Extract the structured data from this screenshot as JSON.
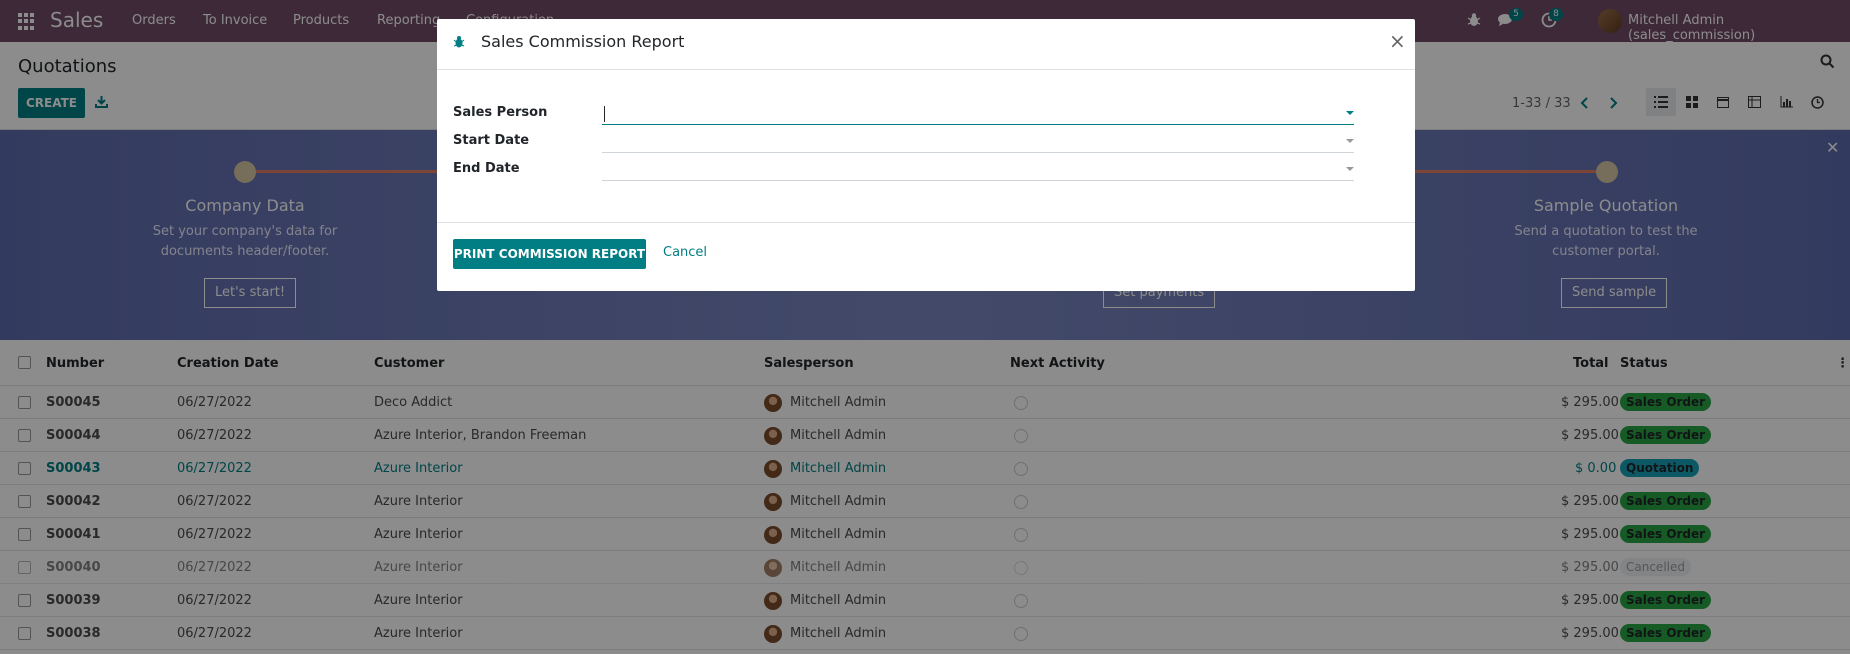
{
  "navbar": {
    "brand": "Sales",
    "menu": [
      "Orders",
      "To Invoice",
      "Products",
      "Reporting",
      "Configuration"
    ],
    "messages_count": "5",
    "activities_count": "8",
    "user": "Mitchell Admin (sales_commission)"
  },
  "control_panel": {
    "title": "Quotations",
    "create_label": "CREATE",
    "pager": "1-33 / 33"
  },
  "banner": {
    "steps": [
      {
        "title": "Company Data",
        "desc1": "Set your company's data for",
        "desc2": "documents header/footer.",
        "button": "Let's start!"
      },
      {
        "title": "Sample Quotation",
        "desc1": "Send a quotation to test the",
        "desc2": "customer portal.",
        "button": "Send sample"
      }
    ],
    "hidden_button": "Set payments"
  },
  "list": {
    "headers": {
      "number": "Number",
      "date": "Creation Date",
      "customer": "Customer",
      "salesperson": "Salesperson",
      "activity": "Next Activity",
      "total": "Total",
      "status": "Status"
    },
    "rows": [
      {
        "number": "S00045",
        "date": "06/27/2022",
        "customer": "Deco Addict",
        "salesperson": "Mitchell Admin",
        "total": "$ 295.00",
        "status": "Sales Order"
      },
      {
        "number": "S00044",
        "date": "06/27/2022",
        "customer": "Azure Interior, Brandon Freeman",
        "salesperson": "Mitchell Admin",
        "total": "$ 295.00",
        "status": "Sales Order"
      },
      {
        "number": "S00043",
        "date": "06/27/2022",
        "customer": "Azure Interior",
        "salesperson": "Mitchell Admin",
        "total": "$ 0.00",
        "status": "Quotation"
      },
      {
        "number": "S00042",
        "date": "06/27/2022",
        "customer": "Azure Interior",
        "salesperson": "Mitchell Admin",
        "total": "$ 295.00",
        "status": "Sales Order"
      },
      {
        "number": "S00041",
        "date": "06/27/2022",
        "customer": "Azure Interior",
        "salesperson": "Mitchell Admin",
        "total": "$ 295.00",
        "status": "Sales Order"
      },
      {
        "number": "S00040",
        "date": "06/27/2022",
        "customer": "Azure Interior",
        "salesperson": "Mitchell Admin",
        "total": "$ 295.00",
        "status": "Cancelled"
      },
      {
        "number": "S00039",
        "date": "06/27/2022",
        "customer": "Azure Interior",
        "salesperson": "Mitchell Admin",
        "total": "$ 295.00",
        "status": "Sales Order"
      },
      {
        "number": "S00038",
        "date": "06/27/2022",
        "customer": "Azure Interior",
        "salesperson": "Mitchell Admin",
        "total": "$ 295.00",
        "status": "Sales Order"
      }
    ]
  },
  "modal": {
    "title": "Sales Commission Report",
    "fields": {
      "sales_person": "Sales Person",
      "start_date": "Start Date",
      "end_date": "End Date"
    },
    "print_label": "PRINT COMMISSION REPORT",
    "cancel_label": "Cancel",
    "close_glyph": "×"
  }
}
